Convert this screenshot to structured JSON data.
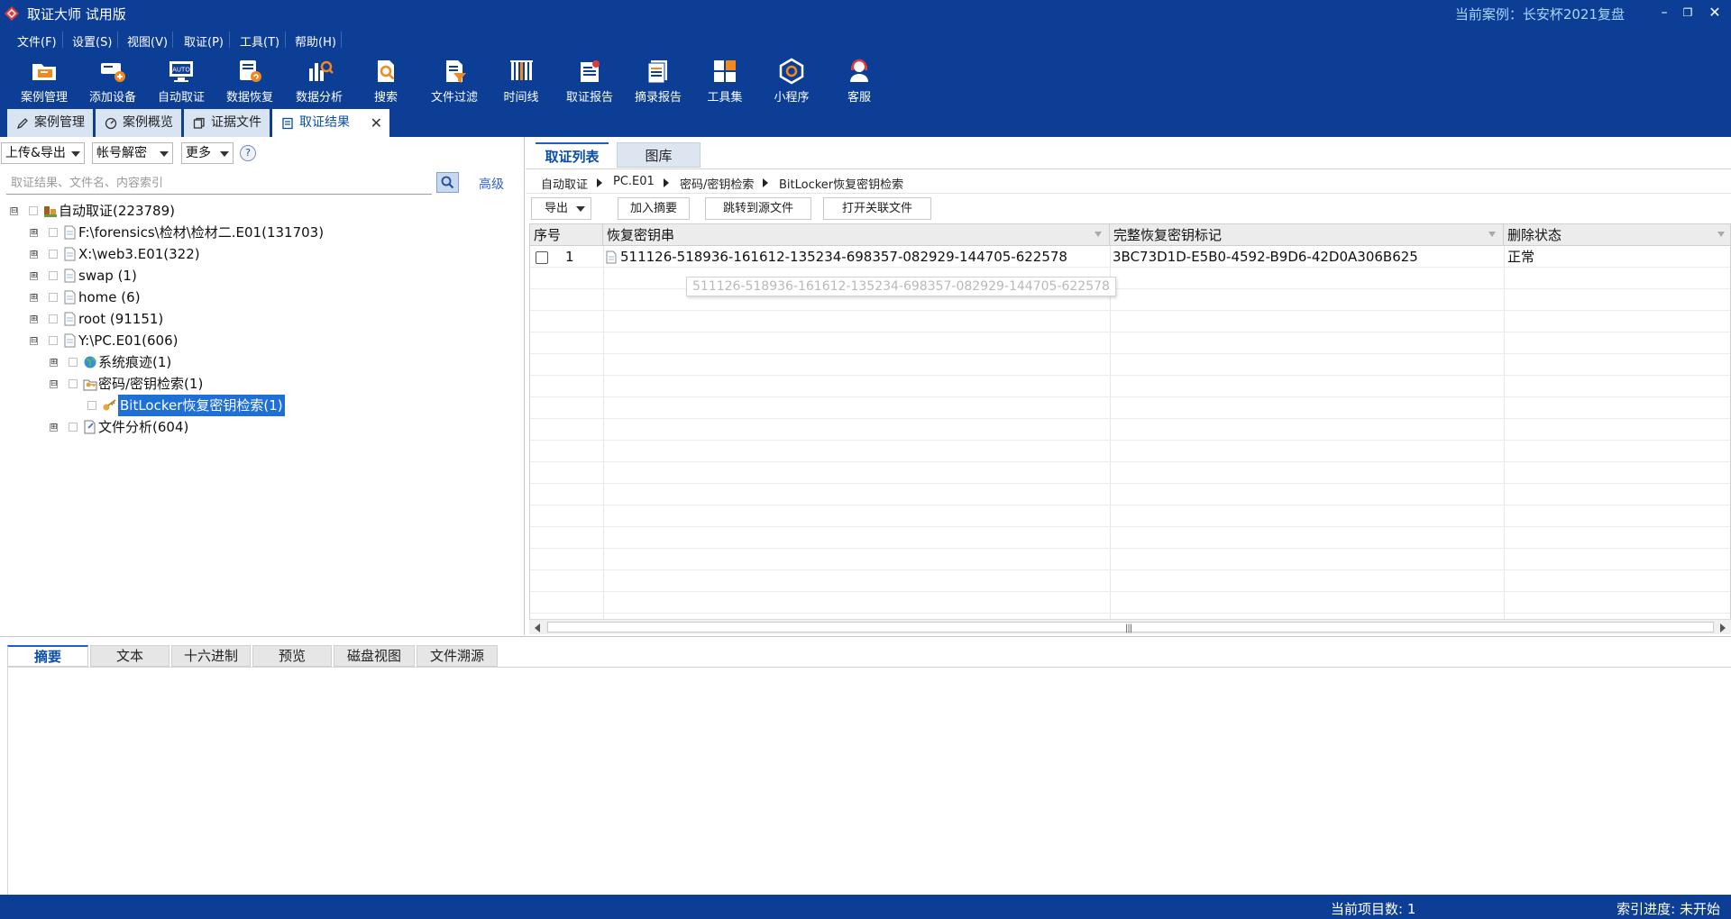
{
  "window": {
    "title": "取证大师 试用版",
    "current_case": "当前案例：长安杯2021复盘",
    "controls": [
      "minimize",
      "restore",
      "close"
    ]
  },
  "menu": [
    "文件(F)",
    "设置(S)",
    "视图(V)",
    "取证(P)",
    "工具(T)",
    "帮助(H)"
  ],
  "toolbar": [
    {
      "label": "案例管理",
      "icon": "folder-case-icon"
    },
    {
      "label": "添加设备",
      "icon": "add-device-icon"
    },
    {
      "label": "自动取证",
      "icon": "auto-forensics-icon"
    },
    {
      "label": "数据恢复",
      "icon": "data-recovery-icon"
    },
    {
      "label": "数据分析",
      "icon": "data-analysis-icon"
    },
    {
      "label": "搜索",
      "icon": "search-doc-icon"
    },
    {
      "label": "文件过滤",
      "icon": "file-filter-icon"
    },
    {
      "label": "时间线",
      "icon": "timeline-icon"
    },
    {
      "label": "取证报告",
      "icon": "forensic-report-icon"
    },
    {
      "label": "摘录报告",
      "icon": "excerpt-report-icon"
    },
    {
      "label": "工具集",
      "icon": "toolset-icon"
    },
    {
      "label": "小程序",
      "icon": "mini-program-icon"
    },
    {
      "label": "客服",
      "icon": "customer-service-icon"
    }
  ],
  "doc_tabs": [
    "案例管理",
    "案例概览",
    "证据文件",
    "取证结果"
  ],
  "active_doc_tab": "取证结果",
  "left": {
    "upload_export": "上传&导出",
    "account_decrypt": "帐号解密",
    "more": "更多",
    "help": "?",
    "search_placeholder": "取证结果、文件名、内容索引",
    "advanced": "高级",
    "tree": [
      {
        "label": "自动取证(223789)",
        "expander": "⊟"
      },
      {
        "label": "F:\\forensics\\检材\\检材二.E01(131703)",
        "expander": "⊞"
      },
      {
        "label": "X:\\web3.E01(322)",
        "expander": "⊞"
      },
      {
        "label": "swap (1)",
        "expander": "⊞"
      },
      {
        "label": "home (6)",
        "expander": "⊞"
      },
      {
        "label": "root (91151)",
        "expander": "⊞"
      },
      {
        "label": "Y:\\PC.E01(606)",
        "expander": "⊟"
      },
      {
        "label": "系统痕迹(1)",
        "expander": "⊞"
      },
      {
        "label": "密码/密钥检索(1)",
        "expander": "⊟"
      },
      {
        "label": "BitLocker恢复密钥检索(1)",
        "expander": ""
      },
      {
        "label": "文件分析(604)",
        "expander": "⊞"
      }
    ]
  },
  "right": {
    "tabs": [
      "取证列表",
      "图库"
    ],
    "breadcrumb": [
      "自动取证",
      "PC.E01",
      "密码/密钥检索",
      "BitLocker恢复密钥检索"
    ],
    "actions": {
      "export": "导出",
      "add_summary": "加入摘要",
      "jump_source": "跳转到源文件",
      "open_related": "打开关联文件"
    },
    "columns": [
      "序号",
      "恢复密钥串",
      "完整恢复密钥标记",
      "删除状态"
    ],
    "rows": [
      {
        "index": "1",
        "key": "511126-518936-161612-135234-698357-082929-144705-622578",
        "id": "3BC73D1D-E5B0-4592-B9D6-42D0A306B625",
        "status": "正常"
      }
    ],
    "tooltip": "511126-518936-161612-135234-698357-082929-144705-622578"
  },
  "bottom": {
    "tabs": [
      "摘要",
      "文本",
      "十六进制",
      "预览",
      "磁盘视图",
      "文件溯源"
    ],
    "active": "摘要"
  },
  "status": {
    "items": "当前项目数: 1",
    "index_progress": "索引进度: 未开始"
  },
  "colors": {
    "titlebar": "#0c3e96",
    "accent": "#1e6fd6",
    "case_text": "#a9d6ff"
  }
}
